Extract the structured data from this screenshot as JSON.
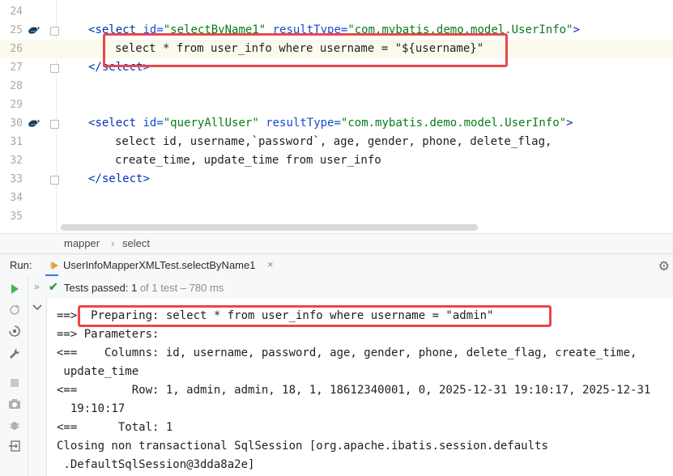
{
  "editor": {
    "lines": [
      {
        "num": "24",
        "text": ""
      },
      {
        "num": "25",
        "parts": [
          {
            "t": "<",
            "c": "tag"
          },
          {
            "t": "select ",
            "c": "tag"
          },
          {
            "t": "id=",
            "c": "attr"
          },
          {
            "t": "\"selectByName1\" ",
            "c": "str"
          },
          {
            "t": "resultType=",
            "c": "attr"
          },
          {
            "t": "\"com.mybatis.demo.model.UserInfo\"",
            "c": "str"
          },
          {
            "t": ">",
            "c": "tag"
          }
        ]
      },
      {
        "num": "26",
        "text": "select * from user_info where username = \"${username}\""
      },
      {
        "num": "27",
        "parts": [
          {
            "t": "</",
            "c": "tag"
          },
          {
            "t": "select",
            "c": "tag"
          },
          {
            "t": ">",
            "c": "tag"
          }
        ]
      },
      {
        "num": "28",
        "text": ""
      },
      {
        "num": "29",
        "text": ""
      },
      {
        "num": "30",
        "parts": [
          {
            "t": "<",
            "c": "tag"
          },
          {
            "t": "select ",
            "c": "tag"
          },
          {
            "t": "id=",
            "c": "attr"
          },
          {
            "t": "\"queryAllUser\" ",
            "c": "str"
          },
          {
            "t": "resultType=",
            "c": "attr"
          },
          {
            "t": "\"com.mybatis.demo.model.UserInfo\"",
            "c": "str"
          },
          {
            "t": ">",
            "c": "tag"
          }
        ]
      },
      {
        "num": "31",
        "text": "select id, username,`password`, age, gender, phone, delete_flag,"
      },
      {
        "num": "32",
        "text": "create_time, update_time from user_info"
      },
      {
        "num": "33",
        "parts": [
          {
            "t": "</",
            "c": "tag"
          },
          {
            "t": "select",
            "c": "tag"
          },
          {
            "t": ">",
            "c": "tag"
          }
        ]
      },
      {
        "num": "34",
        "text": ""
      },
      {
        "num": "35",
        "text": ""
      }
    ]
  },
  "breadcrumb": {
    "item1": "mapper",
    "sep": "›",
    "item2": "select"
  },
  "run": {
    "label": "Run:",
    "tab_title": "UserInfoMapperXMLTest.selectByName1",
    "tab_close": "×",
    "gear": "⚙"
  },
  "status": {
    "chevron": "»",
    "check": "✔",
    "passed_label": "Tests passed: ",
    "passed_count": "1",
    "detail": " of 1 test – 780 ms"
  },
  "console": {
    "lines": [
      "==>  Preparing: select * from user_info where username = \"admin\"",
      "==> Parameters: ",
      "<==    Columns: id, username, password, age, gender, phone, delete_flag, create_time,",
      " update_time",
      "<==        Row: 1, admin, admin, 18, 1, 18612340001, 0, 2025-12-31 19:10:17, 2025-12-31",
      "  19:10:17",
      "<==      Total: 1",
      "Closing non transactional SqlSession [org.apache.ibatis.session.defaults",
      " .DefaultSqlSession@3dda8a2e]"
    ]
  },
  "colors": {
    "highlight_box": "#e8484c",
    "tab_underline": "#3574f0",
    "pass_green": "#3a9a3a"
  }
}
